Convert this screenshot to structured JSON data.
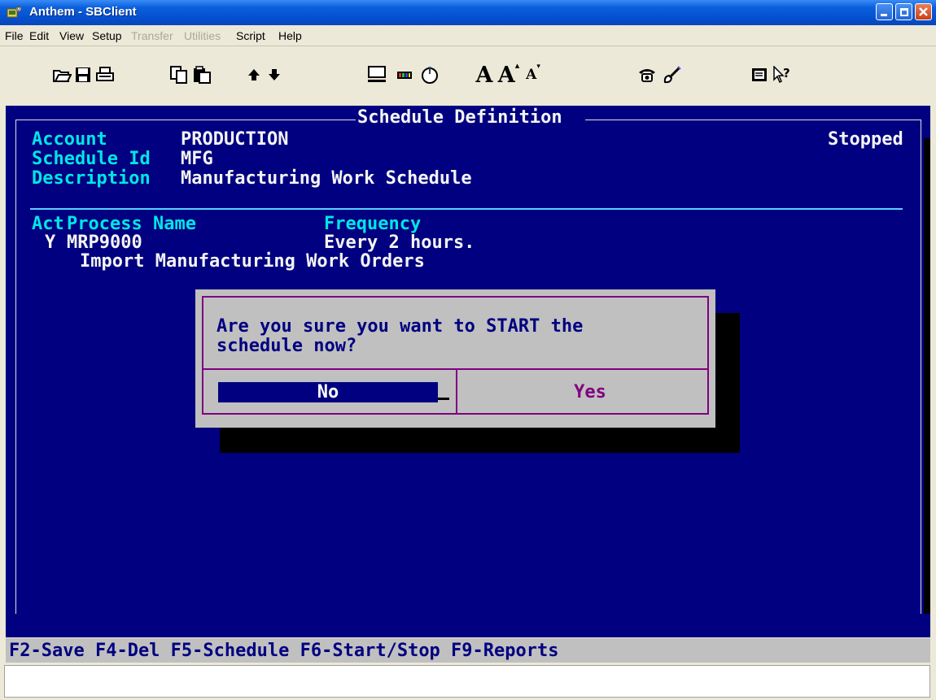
{
  "window": {
    "title": "Anthem - SBClient",
    "icon": "terminal-app-icon"
  },
  "menu": [
    {
      "label": "File",
      "enabled": true
    },
    {
      "label": "Edit",
      "enabled": true
    },
    {
      "label": "View",
      "enabled": true
    },
    {
      "label": "Setup",
      "enabled": true
    },
    {
      "label": "Transfer",
      "enabled": false
    },
    {
      "label": "Utilities",
      "enabled": false
    },
    {
      "label": "Script",
      "enabled": true
    },
    {
      "label": "Help",
      "enabled": true
    }
  ],
  "toolbar": {
    "icons": [
      "open-folder-icon",
      "save-disk-icon",
      "print-icon",
      "copy-icon",
      "paste-icon",
      "arrow-up-icon",
      "arrow-down-icon",
      "monitor-icon",
      "color-palette-icon",
      "mouse-icon",
      "font-large-icon",
      "font-increase-icon",
      "font-decrease-icon",
      "phone-icon",
      "brush-icon",
      "terminal-screen-icon",
      "context-help-icon"
    ],
    "font_large": "A",
    "font_increase": "A",
    "font_decrease": "A"
  },
  "screen": {
    "title": "Schedule Definition",
    "fields": {
      "account_label": "Account",
      "account_value": "PRODUCTION",
      "schedule_id_label": "Schedule Id",
      "schedule_id_value": "MFG",
      "description_label": "Description",
      "description_value": "Manufacturing Work Schedule"
    },
    "status": "Stopped",
    "table": {
      "headers": {
        "act": "Act",
        "process_name": "Process Name",
        "frequency": "Frequency"
      },
      "rows": [
        {
          "act": "Y",
          "process_name": "MRP9000",
          "frequency": "Every 2 hours.",
          "description": "Import Manufacturing Work Orders"
        }
      ]
    }
  },
  "dialog": {
    "message_line1": "Are you sure you want to START the",
    "message_line2": "schedule now?",
    "no_label": "No",
    "yes_label": "Yes"
  },
  "fkeys": "F2-Save F4-Del F5-Schedule F6-Start/Stop F9-Reports",
  "colors": {
    "terminal_bg": "#000080",
    "label_cyan": "#00e6e6",
    "dialog_bg": "#c0c0c0",
    "dialog_border": "#800080"
  }
}
